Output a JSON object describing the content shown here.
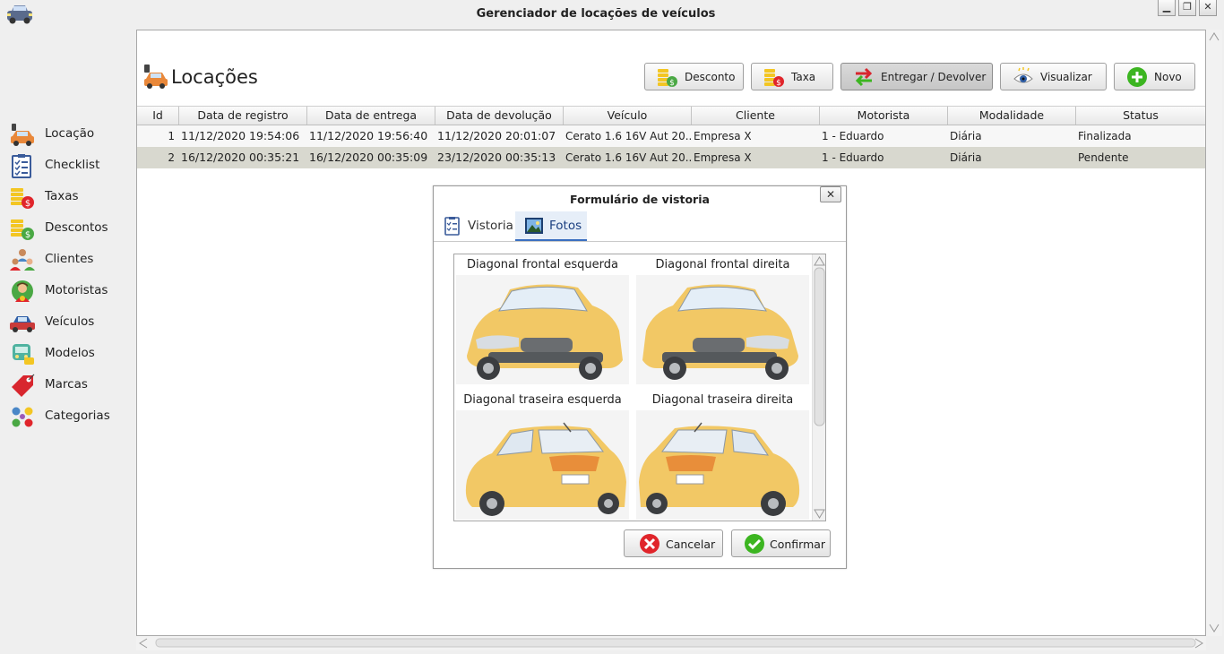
{
  "window": {
    "title": "Gerenciador de locações de veículos",
    "controls": [
      "minimize-icon",
      "restore-icon",
      "close-icon"
    ]
  },
  "sidebar": {
    "items": [
      {
        "label": "Locação",
        "icon": "car-rental-icon"
      },
      {
        "label": "Checklist",
        "icon": "checklist-icon"
      },
      {
        "label": "Taxas",
        "icon": "coins-fee-icon"
      },
      {
        "label": "Descontos",
        "icon": "coins-discount-icon"
      },
      {
        "label": "Clientes",
        "icon": "clients-icon"
      },
      {
        "label": "Motoristas",
        "icon": "driver-icon"
      },
      {
        "label": "Veículos",
        "icon": "car-icon"
      },
      {
        "label": "Modelos",
        "icon": "car-model-icon"
      },
      {
        "label": "Marcas",
        "icon": "tag-icon"
      },
      {
        "label": "Categorias",
        "icon": "categories-icon"
      }
    ]
  },
  "page": {
    "title": "Locações",
    "toolbar": {
      "discount": "Desconto",
      "fee": "Taxa",
      "deliver_return": "Entregar / Devolver",
      "view": "Visualizar",
      "new": "Novo"
    }
  },
  "table": {
    "columns": [
      "Id",
      "Data de registro",
      "Data de entrega",
      "Data de devolução",
      "Veículo",
      "Cliente",
      "Motorista",
      "Modalidade",
      "Status"
    ],
    "rows": [
      {
        "id": "1",
        "registro": "11/12/2020 19:54:06",
        "entrega": "11/12/2020 19:56:40",
        "devolucao": "11/12/2020 20:01:07",
        "veiculo": "Cerato 1.6 16V Aut 20...",
        "cliente": "Empresa X",
        "motorista": "1 - Eduardo",
        "modalidade": "Diária",
        "status": "Finalizada"
      },
      {
        "id": "2",
        "registro": "16/12/2020 00:35:21",
        "entrega": "16/12/2020 00:35:09",
        "devolucao": "23/12/2020 00:35:13",
        "veiculo": "Cerato 1.6 16V Aut 20...",
        "cliente": "Empresa X",
        "motorista": "1 - Eduardo",
        "modalidade": "Diária",
        "status": "Pendente"
      }
    ]
  },
  "dialog": {
    "title": "Formulário de vistoria",
    "close": "✕",
    "tabs": [
      {
        "label": "Vistoria"
      },
      {
        "label": "Fotos",
        "selected": true
      }
    ],
    "photos": [
      {
        "caption": "Diagonal frontal esquerda"
      },
      {
        "caption": "Diagonal frontal direita"
      },
      {
        "caption": "Diagonal traseira esquerda"
      },
      {
        "caption": "Diagonal traseira direita"
      }
    ],
    "cancel": "Cancelar",
    "confirm": "Confirmar"
  },
  "colors": {
    "car_yellow": "#f2c865",
    "selected_row": "#d8d8cf",
    "tab_accent": "#3a6fc0",
    "cancel_red": "#e0252b",
    "confirm_green": "#3cb521"
  }
}
